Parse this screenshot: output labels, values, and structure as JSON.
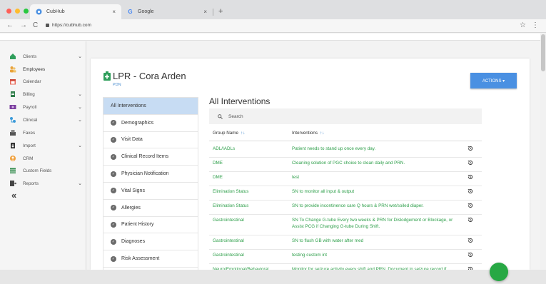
{
  "browser": {
    "tabs": [
      {
        "title": "CubHub",
        "close": "×"
      },
      {
        "title": "Google",
        "close": "×"
      }
    ],
    "new_tab": "+",
    "url": "https://cubhub.com",
    "nav": {
      "back": "←",
      "forward": "→",
      "reload": "C"
    },
    "star": "☆",
    "menu": "⋮",
    "colors": {
      "red": "#ff5f57",
      "yellow": "#febc2e",
      "green": "#28c840"
    }
  },
  "sidebar": {
    "items": [
      {
        "label": "Clients",
        "icon": "home-icon",
        "chevron": "⌄"
      },
      {
        "label": "Employees",
        "icon": "people-icon",
        "chevron": ""
      },
      {
        "label": "Calendar",
        "icon": "calendar-icon",
        "chevron": ""
      },
      {
        "label": "Billing",
        "icon": "document-icon",
        "chevron": "⌄"
      },
      {
        "label": "Payroll",
        "icon": "payroll-icon",
        "chevron": "⌄"
      },
      {
        "label": "Clinical",
        "icon": "clinical-icon",
        "chevron": "⌄"
      },
      {
        "label": "Faxes",
        "icon": "fax-icon",
        "chevron": ""
      },
      {
        "label": "Import",
        "icon": "import-icon",
        "chevron": "⌄"
      },
      {
        "label": "CRM",
        "icon": "crm-icon",
        "chevron": ""
      },
      {
        "label": "Custom Fields",
        "icon": "fields-icon",
        "chevron": ""
      },
      {
        "label": "Reports",
        "icon": "reports-icon",
        "chevron": "⌄"
      }
    ],
    "collapse": "«"
  },
  "header": {
    "title": "LPR - Cora Arden",
    "subtitle": "PDN",
    "actions_label": "ACTIONS ▾"
  },
  "leftnav": {
    "items": [
      {
        "label": "All Interventions",
        "active": true
      },
      {
        "label": "Demographics",
        "active": false
      },
      {
        "label": "Visit Data",
        "active": false
      },
      {
        "label": "Clinical Record Items",
        "active": false
      },
      {
        "label": "Physician Notification",
        "active": false
      },
      {
        "label": "Vital Signs",
        "active": false
      },
      {
        "label": "Allergies",
        "active": false
      },
      {
        "label": "Patient History",
        "active": false
      },
      {
        "label": "Diagnoses",
        "active": false
      },
      {
        "label": "Risk Assessment",
        "active": false
      }
    ]
  },
  "main": {
    "title": "All Interventions",
    "search_placeholder": "Search",
    "columns": [
      "Group Name",
      "Interventions"
    ],
    "sort_indicator": "↑↓",
    "rows": [
      {
        "group": "ADL/IADLs",
        "intervention": "Patient needs to stand up once every day."
      },
      {
        "group": "DME",
        "intervention": "Cleaning solution of PGC choice to clean daily and PRN."
      },
      {
        "group": "DME",
        "intervention": "test"
      },
      {
        "group": "Elimination Status",
        "intervention": "SN to monitor all input & output"
      },
      {
        "group": "Elimination Status",
        "intervention": "SN to provide incontinence care Q hours & PRN wet/soiled diaper."
      },
      {
        "group": "Gastrointestinal",
        "intervention": "SN To Change G-tube Every two weeks & PRN for Dislodgement or Blockage, or Assist PCG if Changing G-tube During Shift."
      },
      {
        "group": "Gastrointestinal",
        "intervention": "SN to flush GB with water after med"
      },
      {
        "group": "Gastrointestinal",
        "intervention": "testing custom int"
      },
      {
        "group": "Neuro/Emotional/Behavioral",
        "intervention": "Monitor for seizure activity every shift and PRN. Document in seizure record if"
      }
    ]
  },
  "colors": {
    "accent": "#4a90e2",
    "green_text": "#2e9f4a",
    "active_nav": "#c7dcf3",
    "fab": "#27a844"
  }
}
